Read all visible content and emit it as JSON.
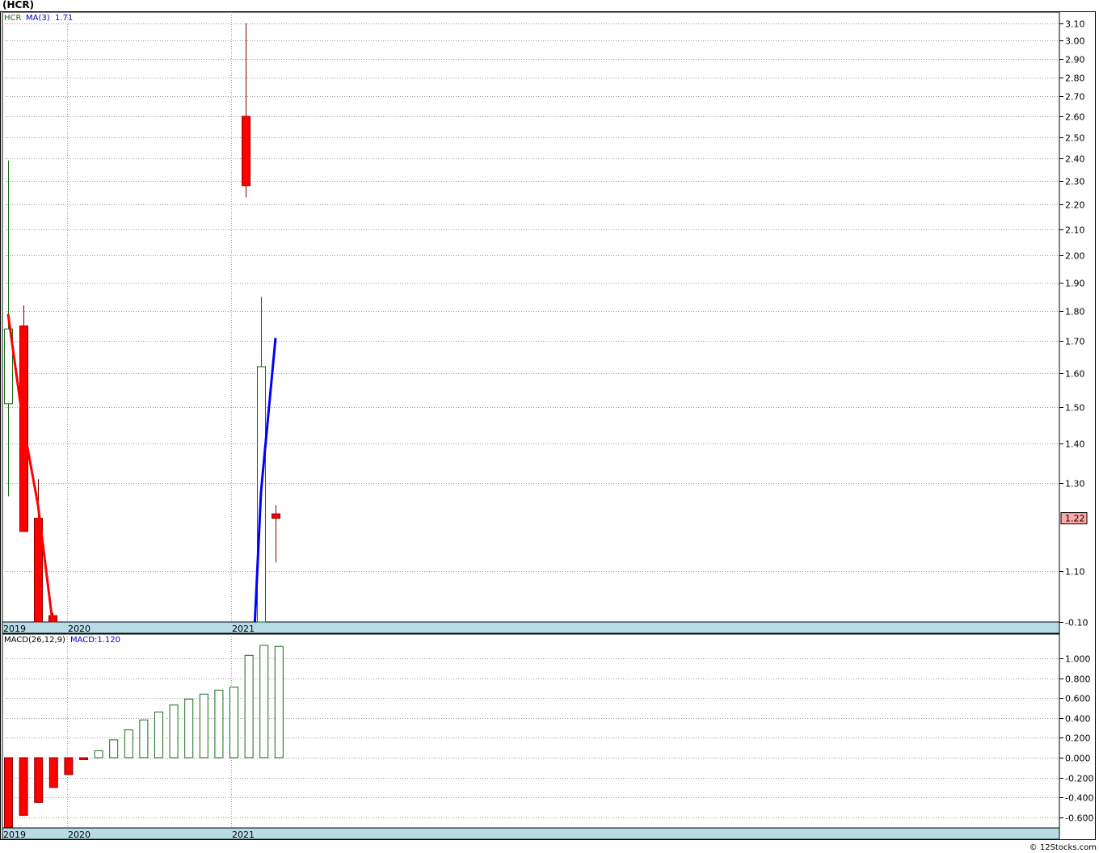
{
  "title": "(HCR)",
  "copyright": "© 12Stocks.com",
  "colors": {
    "up_candle": "#1a6b1a",
    "down_candle": "#ff0000",
    "ma_down": "#ff0000",
    "ma_up": "#0000ff",
    "date_strip": "#b8dce6",
    "last_price_bg": "#ffa8a8",
    "grid": "#999999",
    "macd_pos": "#1a6b1a",
    "macd_neg": "#ff0000"
  },
  "chart_data": [
    {
      "type": "candlestick",
      "symbol_label": "HCR",
      "indicator_label": "MA(3)",
      "indicator_value": "1.71",
      "last_price": "1.22",
      "y_ticks": [
        "3.10",
        "3.00",
        "2.90",
        "2.80",
        "2.70",
        "2.60",
        "2.50",
        "2.40",
        "2.30",
        "2.20",
        "2.10",
        "2.00",
        "1.90",
        "1.80",
        "1.70",
        "1.60",
        "1.50",
        "1.40",
        "1.30",
        "1.10",
        "-0.10"
      ],
      "x_labels": [
        "2019",
        "2020",
        "2021"
      ],
      "grid": true,
      "candles": [
        {
          "open": 1.51,
          "high": 2.39,
          "low": 1.27,
          "close": 1.74
        },
        {
          "open": 1.75,
          "high": 1.82,
          "low": 1.19,
          "close": 1.19
        },
        {
          "open": 1.22,
          "high": 1.31,
          "low": -0.1,
          "close": -0.1
        },
        {
          "open": 0.05,
          "high": 0.12,
          "low": -0.1,
          "close": -0.1
        },
        {
          "open": 2.6,
          "high": 3.1,
          "low": 2.23,
          "close": 2.28
        },
        {
          "open": -0.1,
          "high": 1.85,
          "low": -0.1,
          "close": 1.62
        },
        {
          "open": 1.23,
          "high": 1.25,
          "low": 1.12,
          "close": 1.22
        }
      ],
      "ma_series": [
        {
          "name": "MA(3)",
          "segment": "down",
          "points": [
            [
              0,
              1.79
            ],
            [
              1,
              1.45
            ],
            [
              2,
              1.25
            ],
            [
              3,
              -0.1
            ]
          ]
        },
        {
          "name": "MA(3)",
          "segment": "up",
          "points": [
            [
              4.6,
              -0.1
            ],
            [
              5,
              1.28
            ],
            [
              6,
              1.71
            ]
          ]
        }
      ]
    },
    {
      "type": "bar",
      "indicator_label": "MACD(26,12,9)",
      "indicator_value": "MACD:1.120",
      "y_ticks": [
        "1.000",
        "0.800",
        "0.600",
        "0.400",
        "0.200",
        "0.000",
        "-0.200",
        "-0.400",
        "-0.600"
      ],
      "x_labels": [
        "2019",
        "2020",
        "2021"
      ],
      "grid": true,
      "values": [
        -0.7,
        -0.58,
        -0.45,
        -0.3,
        -0.17,
        -0.02,
        0.07,
        0.18,
        0.28,
        0.38,
        0.46,
        0.53,
        0.59,
        0.64,
        0.68,
        0.71,
        1.03,
        1.13,
        1.12
      ]
    }
  ]
}
